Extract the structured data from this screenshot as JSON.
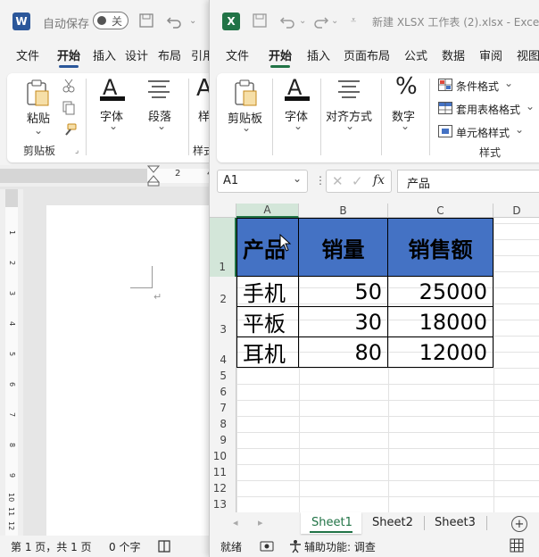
{
  "word": {
    "autosave_label": "自动保存",
    "autosave_toggle": "关",
    "tabs": [
      "文件",
      "开始",
      "插入",
      "设计",
      "布局",
      "引用"
    ],
    "active_tab": "开始",
    "ribbon": {
      "paste": "粘贴",
      "font": "字体",
      "paragraph": "段落",
      "style_partial": "样",
      "clipboard_group": "剪贴板",
      "styles_group_partial": "样式"
    },
    "ruler_marks": [
      "2",
      "4"
    ],
    "vruler_marks": [
      "1",
      "2",
      "3",
      "4",
      "5",
      "6",
      "7",
      "8",
      "9",
      "10",
      "11",
      "12"
    ],
    "status": {
      "page": "第 1 页，共 1 页",
      "words": "0 个字"
    }
  },
  "excel": {
    "title": "新建 XLSX 工作表 (2).xlsx  -  Exce",
    "tabs": [
      "文件",
      "开始",
      "插入",
      "页面布局",
      "公式",
      "数据",
      "审阅",
      "视图"
    ],
    "active_tab": "开始",
    "ribbon": {
      "paste": "粘贴",
      "clipboard_group": "剪贴板",
      "font": "字体",
      "alignment": "对齐方式",
      "number": "数字",
      "conditional_format": "条件格式",
      "table_format": "套用表格格式",
      "cell_style": "单元格样式",
      "styles_group": "样式"
    },
    "name_box": "A1",
    "fx_label": "fx",
    "formula_value": "产品",
    "columns": [
      "A",
      "B",
      "C",
      "D"
    ],
    "header": [
      "产品",
      "销量",
      "销售额"
    ],
    "rows": [
      [
        "手机",
        "50",
        "25000"
      ],
      [
        "平板",
        "30",
        "18000"
      ],
      [
        "耳机",
        "80",
        "12000"
      ]
    ],
    "row_numbers": [
      "1",
      "2",
      "3",
      "4",
      "5",
      "6",
      "7",
      "8",
      "9",
      "10",
      "11",
      "12",
      "13"
    ],
    "sheets": [
      "Sheet1",
      "Sheet2",
      "Sheet3"
    ],
    "active_sheet": "Sheet1",
    "status": {
      "ready": "就绪",
      "accessibility": "辅助功能: 调查"
    }
  },
  "colors": {
    "header_fill": "#4472c4",
    "excel_green": "#217346",
    "word_blue": "#2b579a"
  }
}
